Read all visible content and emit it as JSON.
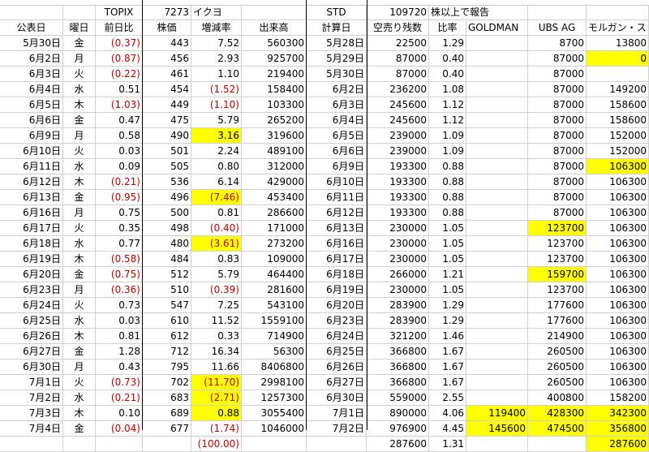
{
  "headers": {
    "row1": [
      "",
      "",
      "TOPIX",
      "7273",
      "イクヨ",
      "",
      "",
      "STD",
      "109720",
      "株以上で報告",
      "",
      "",
      ""
    ],
    "row2": [
      "公表日",
      "曜日",
      "前日比",
      "株価",
      "増減率",
      "出来高",
      "",
      "計算日",
      "空売り残数",
      "比率",
      "GOLDMAN",
      "UBS AG",
      "モルガン・ス"
    ]
  },
  "rows": [
    {
      "date": "5月30日",
      "dow": "金",
      "topix": "(0.37)",
      "price": "443",
      "chg": "7.52",
      "vol": "560300",
      "calc": "5月28日",
      "short": "22500",
      "ratio": "1.29",
      "gs": "",
      "ubs": "8700",
      "ms": "13800"
    },
    {
      "date": "6月2日",
      "dow": "月",
      "topix": "(0.87)",
      "price": "456",
      "chg": "2.93",
      "vol": "925700",
      "calc": "5月29日",
      "short": "87000",
      "ratio": "0.40",
      "gs": "",
      "ubs": "87000",
      "ms": "0"
    },
    {
      "date": "6月3日",
      "dow": "火",
      "topix": "(0.22)",
      "price": "461",
      "chg": "1.10",
      "vol": "219400",
      "calc": "5月30日",
      "short": "87000",
      "ratio": "0.40",
      "gs": "",
      "ubs": "87000",
      "ms": ""
    },
    {
      "date": "6月4日",
      "dow": "水",
      "topix": "0.51",
      "price": "454",
      "chg": "(1.52)",
      "vol": "158400",
      "calc": "6月2日",
      "short": "236200",
      "ratio": "1.08",
      "gs": "",
      "ubs": "87000",
      "ms": "149200"
    },
    {
      "date": "6月5日",
      "dow": "木",
      "topix": "(1.03)",
      "price": "449",
      "chg": "(1.10)",
      "vol": "103300",
      "calc": "6月3日",
      "short": "245600",
      "ratio": "1.12",
      "gs": "",
      "ubs": "87000",
      "ms": "158600"
    },
    {
      "date": "6月6日",
      "dow": "金",
      "topix": "0.47",
      "price": "475",
      "chg": "5.79",
      "vol": "265200",
      "calc": "6月4日",
      "short": "245600",
      "ratio": "1.12",
      "gs": "",
      "ubs": "87000",
      "ms": "158600"
    },
    {
      "date": "6月9日",
      "dow": "月",
      "topix": "0.58",
      "price": "490",
      "chg": "3.16",
      "vol": "319600",
      "calc": "6月5日",
      "short": "239000",
      "ratio": "1.09",
      "gs": "",
      "ubs": "87000",
      "ms": "152000"
    },
    {
      "date": "6月10日",
      "dow": "火",
      "topix": "0.03",
      "price": "501",
      "chg": "2.24",
      "vol": "489100",
      "calc": "6月6日",
      "short": "239000",
      "ratio": "1.09",
      "gs": "",
      "ubs": "87000",
      "ms": "152000"
    },
    {
      "date": "6月11日",
      "dow": "水",
      "topix": "0.09",
      "price": "505",
      "chg": "0.80",
      "vol": "312000",
      "calc": "6月9日",
      "short": "193300",
      "ratio": "0.88",
      "gs": "",
      "ubs": "87000",
      "ms": "106300"
    },
    {
      "date": "6月12日",
      "dow": "木",
      "topix": "(0.21)",
      "price": "536",
      "chg": "6.14",
      "vol": "429000",
      "calc": "6月10日",
      "short": "193300",
      "ratio": "0.88",
      "gs": "",
      "ubs": "87000",
      "ms": "106300"
    },
    {
      "date": "6月13日",
      "dow": "金",
      "topix": "(0.95)",
      "price": "496",
      "chg": "(7.46)",
      "vol": "453400",
      "calc": "6月11日",
      "short": "193300",
      "ratio": "0.88",
      "gs": "",
      "ubs": "87000",
      "ms": "106300"
    },
    {
      "date": "6月16日",
      "dow": "月",
      "topix": "0.75",
      "price": "500",
      "chg": "0.81",
      "vol": "286600",
      "calc": "6月12日",
      "short": "193300",
      "ratio": "0.88",
      "gs": "",
      "ubs": "87000",
      "ms": "106300"
    },
    {
      "date": "6月17日",
      "dow": "火",
      "topix": "0.35",
      "price": "498",
      "chg": "(0.40)",
      "vol": "171000",
      "calc": "6月13日",
      "short": "230000",
      "ratio": "1.05",
      "gs": "",
      "ubs": "123700",
      "ms": "106300"
    },
    {
      "date": "6月18日",
      "dow": "水",
      "topix": "0.77",
      "price": "480",
      "chg": "(3.61)",
      "vol": "273200",
      "calc": "6月16日",
      "short": "230000",
      "ratio": "1.05",
      "gs": "",
      "ubs": "123700",
      "ms": "106300"
    },
    {
      "date": "6月19日",
      "dow": "木",
      "topix": "(0.58)",
      "price": "484",
      "chg": "0.83",
      "vol": "109000",
      "calc": "6月17日",
      "short": "230000",
      "ratio": "1.05",
      "gs": "",
      "ubs": "123700",
      "ms": "106300"
    },
    {
      "date": "6月20日",
      "dow": "金",
      "topix": "(0.75)",
      "price": "512",
      "chg": "5.79",
      "vol": "464400",
      "calc": "6月18日",
      "short": "266000",
      "ratio": "1.21",
      "gs": "",
      "ubs": "159700",
      "ms": "106300"
    },
    {
      "date": "6月23日",
      "dow": "月",
      "topix": "(0.36)",
      "price": "510",
      "chg": "(0.39)",
      "vol": "281600",
      "calc": "6月19日",
      "short": "230000",
      "ratio": "1.05",
      "gs": "",
      "ubs": "123700",
      "ms": "106300"
    },
    {
      "date": "6月24日",
      "dow": "火",
      "topix": "0.73",
      "price": "547",
      "chg": "7.25",
      "vol": "543100",
      "calc": "6月20日",
      "short": "283900",
      "ratio": "1.29",
      "gs": "",
      "ubs": "177600",
      "ms": "106300"
    },
    {
      "date": "6月25日",
      "dow": "水",
      "topix": "0.03",
      "price": "610",
      "chg": "11.52",
      "vol": "1559100",
      "calc": "6月23日",
      "short": "283900",
      "ratio": "1.29",
      "gs": "",
      "ubs": "177600",
      "ms": "106300"
    },
    {
      "date": "6月26日",
      "dow": "木",
      "topix": "0.81",
      "price": "612",
      "chg": "0.33",
      "vol": "714900",
      "calc": "6月24日",
      "short": "321200",
      "ratio": "1.46",
      "gs": "",
      "ubs": "214900",
      "ms": "106300"
    },
    {
      "date": "6月27日",
      "dow": "金",
      "topix": "1.28",
      "price": "712",
      "chg": "16.34",
      "vol": "56300",
      "calc": "6月25日",
      "short": "366800",
      "ratio": "1.67",
      "gs": "",
      "ubs": "260500",
      "ms": "106300"
    },
    {
      "date": "6月30日",
      "dow": "月",
      "topix": "0.43",
      "price": "795",
      "chg": "11.66",
      "vol": "8406800",
      "calc": "6月26日",
      "short": "366800",
      "ratio": "1.67",
      "gs": "",
      "ubs": "260500",
      "ms": "106300"
    },
    {
      "date": "7月1日",
      "dow": "火",
      "topix": "(0.73)",
      "price": "702",
      "chg": "(11.70)",
      "vol": "2998100",
      "calc": "6月27日",
      "short": "366800",
      "ratio": "1.67",
      "gs": "",
      "ubs": "260500",
      "ms": "106300"
    },
    {
      "date": "7月2日",
      "dow": "水",
      "topix": "(0.21)",
      "price": "683",
      "chg": "(2.71)",
      "vol": "1257300",
      "calc": "6月30日",
      "short": "559000",
      "ratio": "2.55",
      "gs": "",
      "ubs": "400800",
      "ms": "158200"
    },
    {
      "date": "7月3日",
      "dow": "木",
      "topix": "0.10",
      "price": "689",
      "chg": "0.88",
      "vol": "3055400",
      "calc": "7月1日",
      "short": "890000",
      "ratio": "4.06",
      "gs": "119400",
      "ubs": "428300",
      "ms": "342300"
    },
    {
      "date": "7月4日",
      "dow": "金",
      "topix": "(0.04)",
      "price": "677",
      "chg": "(1.74)",
      "vol": "1046000",
      "calc": "7月2日",
      "short": "976900",
      "ratio": "4.45",
      "gs": "145600",
      "ubs": "474500",
      "ms": "356800"
    },
    {
      "date": "",
      "dow": "",
      "topix": "",
      "price": "",
      "chg": "(100.00)",
      "vol": "",
      "calc": "",
      "short": "287600",
      "ratio": "1.31",
      "gs": "",
      "ubs": "",
      "ms": "287600"
    }
  ],
  "highlights": {
    "chg": [
      6,
      10,
      13,
      22,
      23,
      24
    ],
    "ubs": [
      12,
      15,
      24,
      25
    ],
    "gs": [
      24,
      25
    ],
    "ms": [
      1,
      8,
      24,
      25,
      26
    ]
  },
  "colors": {
    "highlight": "#ffff00",
    "negative": "#c00000",
    "grid": "#d0d0d0"
  }
}
